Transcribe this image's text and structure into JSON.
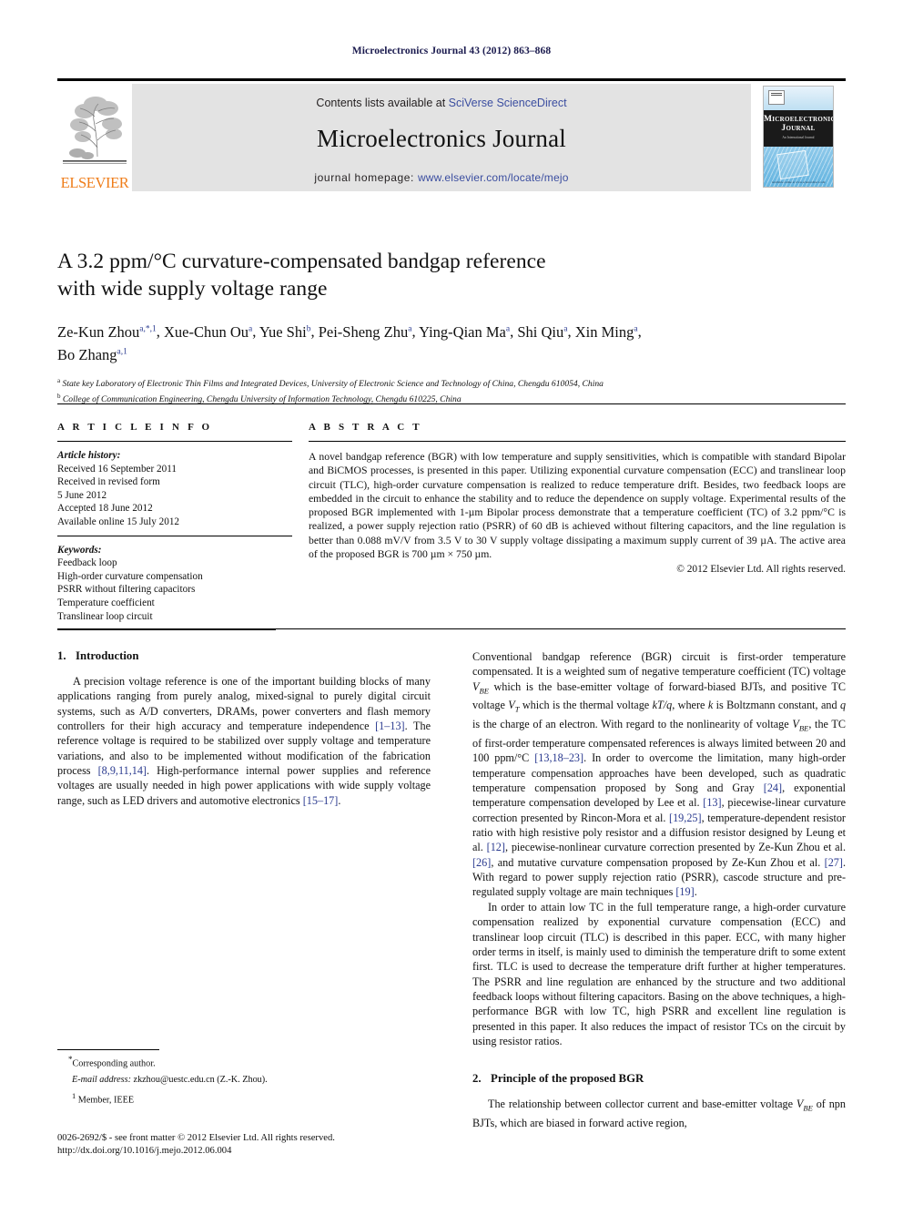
{
  "running_head": "Microelectronics Journal 43 (2012) 863–868",
  "masthead": {
    "contents_prefix": "Contents lists available at ",
    "contents_link": "SciVerse ScienceDirect",
    "journal_name": "Microelectronics Journal",
    "homepage_prefix": "journal homepage: ",
    "homepage_link": "www.elsevier.com/locate/mejo",
    "publisher_wordmark": "ELSEVIER",
    "cover": {
      "line1": "Microelectronics",
      "line2": "Journal",
      "line3": "An International Journal",
      "caption": "Available online at www.sciencedirect.com"
    },
    "link_color": "#3b4ea0",
    "panel_color": "#e3e3e3",
    "elsevier_orange": "#ef7d1a"
  },
  "title": {
    "line1": "A 3.2 ppm/°C curvature-compensated bandgap reference",
    "line2": "with wide supply voltage range"
  },
  "authors": {
    "line1": "Ze-Kun Zhou a,*,1, Xue-Chun Ou a, Yue Shi b, Pei-Sheng Zhu a, Ying-Qian Ma a, Shi Qiu a, Xin Ming a,",
    "line2": "Bo Zhang a,1",
    "list": [
      {
        "name": "Ze-Kun Zhou",
        "marks": "a,*,1"
      },
      {
        "name": "Xue-Chun Ou",
        "marks": "a"
      },
      {
        "name": "Yue Shi",
        "marks": "b"
      },
      {
        "name": "Pei-Sheng Zhu",
        "marks": "a"
      },
      {
        "name": "Ying-Qian Ma",
        "marks": "a"
      },
      {
        "name": "Shi Qiu",
        "marks": "a"
      },
      {
        "name": "Xin Ming",
        "marks": "a"
      },
      {
        "name": "Bo Zhang",
        "marks": "a,1"
      }
    ]
  },
  "affiliations": [
    {
      "mark": "a",
      "text": "State key Laboratory of Electronic Thin Films and Integrated Devices, University of Electronic Science and Technology of China, Chengdu 610054, China"
    },
    {
      "mark": "b",
      "text": "College of Communication Engineering, Chengdu University of Information Technology, Chengdu 610225, China"
    }
  ],
  "article_info": {
    "heading": "A R T I C L E  I N F O",
    "history_label": "Article history:",
    "history": [
      "Received 16 September 2011",
      "Received in revised form",
      "5 June 2012",
      "Accepted 18 June 2012",
      "Available online 15 July 2012"
    ],
    "keywords_label": "Keywords:",
    "keywords": [
      "Feedback loop",
      "High-order curvature compensation",
      "PSRR without filtering capacitors",
      "Temperature coefficient",
      "Translinear loop circuit"
    ]
  },
  "abstract": {
    "heading": "A B S T R A C T",
    "text": "A novel bandgap reference (BGR) with low temperature and supply sensitivities, which is compatible with standard Bipolar and BiCMOS processes, is presented in this paper. Utilizing exponential curvature compensation (ECC) and translinear loop circuit (TLC), high-order curvature compensation is realized to reduce temperature drift. Besides, two feedback loops are embedded in the circuit to enhance the stability and to reduce the dependence on supply voltage. Experimental results of the proposed BGR implemented with 1-µm Bipolar process demonstrate that a temperature coefficient (TC) of 3.2 ppm/°C is realized, a power supply rejection ratio (PSRR) of 60 dB is achieved without filtering capacitors, and the line regulation is better than 0.088 mV/V from 3.5 V to 30 V supply voltage dissipating a maximum supply current of 39 µA. The active area of the proposed BGR is 700 µm × 750 µm.",
    "copyright": "© 2012 Elsevier Ltd. All rights reserved."
  },
  "sections": {
    "intro": {
      "number": "1.",
      "title": "Introduction",
      "p1_a": "A precision voltage reference is one of the important building blocks of many applications ranging from purely analog, mixed-signal to purely digital circuit systems, such as A/D converters, DRAMs, power converters and flash memory controllers for their high accuracy and temperature independence ",
      "p1_ref1": "[1–13]",
      "p1_b": ". The reference voltage is required to be stabilized over supply voltage and temperature variations, and also to be implemented without modification of the fabrication process ",
      "p1_ref2": "[8,9,11,14]",
      "p1_c": ". High-performance internal power supplies and reference voltages are usually needed in high power applications with wide supply voltage range, such as LED drivers and automotive electronics ",
      "p1_ref3": "[15–17]",
      "p1_d": ".",
      "p2_a": "Conventional bandgap reference (BGR) circuit is first-order temperature compensated. It is a weighted sum of negative temperature coefficient (TC) voltage ",
      "p2_v1": "VBE",
      "p2_b": " which is the base-emitter voltage of forward-biased BJTs, and positive TC voltage ",
      "p2_v2": "VT",
      "p2_c": " which is the thermal voltage ",
      "p2_v3": "kT/q",
      "p2_d": ", where ",
      "p2_v4": "k",
      "p2_e": " is Boltzmann constant, and ",
      "p2_v5": "q",
      "p2_f": " is the charge of an electron. With regard to the nonlinearity of voltage ",
      "p2_v6": "VBE",
      "p2_g": ", the TC of first-order temperature compensated references is always limited between 20 and 100 ppm/°C ",
      "p2_ref1": "[13,18–23]",
      "p2_h": ". In order to overcome the limitation, many high-order temperature compensation approaches have been developed, such as quadratic temperature compensation proposed by Song and Gray ",
      "p2_ref2": "[24]",
      "p2_i": ", exponential temperature compensation developed by Lee et al. ",
      "p2_ref3": "[13]",
      "p2_j": ", piecewise-linear curvature correction presented by Rincon-Mora et al. ",
      "p2_ref4": "[19,25]",
      "p2_k": ", temperature-dependent resistor ratio with high resistive poly resistor and a diffusion resistor designed by Leung et al. ",
      "p2_ref5": "[12]",
      "p2_l": ", piecewise-nonlinear curvature correction presented by Ze-Kun Zhou et al. ",
      "p2_ref6": "[26]",
      "p2_m": ", and mutative curvature compensation proposed by Ze-Kun Zhou et al. ",
      "p2_ref7": "[27]",
      "p2_n": ". With regard to power supply rejection ratio (PSRR), cascode structure and pre-regulated supply voltage are main techniques ",
      "p2_ref8": "[19]",
      "p2_o": ".",
      "p3": "In order to attain low TC in the full temperature range, a high-order curvature compensation realized by exponential curvature compensation (ECC) and translinear loop circuit (TLC) is described in this paper. ECC, with many higher order terms in itself, is mainly used to diminish the temperature drift to some extent first. TLC is used to decrease the temperature drift further at higher temperatures. The PSRR and line regulation are enhanced by the structure and two additional feedback loops without filtering capacitors. Basing on the above techniques, a high-performance BGR with low TC, high PSRR and excellent line regulation is presented in this paper. It also reduces the impact of resistor TCs on the circuit by using resistor ratios."
    },
    "principle": {
      "number": "2.",
      "title": "Principle of the proposed BGR",
      "p1_a": "The relationship between collector current and base-emitter voltage ",
      "p1_v1": "VBE",
      "p1_b": " of npn BJTs, which are biased in forward active region,"
    }
  },
  "footnotes": {
    "corresponding": "Corresponding author.",
    "email_label": "E-mail address:",
    "email_value": " zkzhou@uestc.edu.cn (Z.-K. Zhou).",
    "member": "Member, IEEE",
    "member_mark": "1"
  },
  "issn_line": "0026-2692/$ - see front matter © 2012 Elsevier Ltd. All rights reserved.",
  "doi_line": "http://dx.doi.org/10.1016/j.mejo.2012.06.004"
}
